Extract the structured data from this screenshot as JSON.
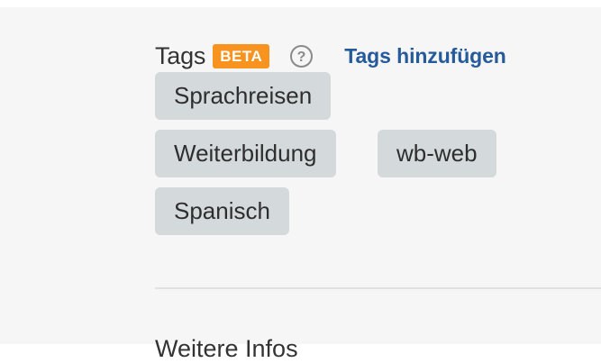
{
  "tags_section": {
    "title": "Tags",
    "badge": "BETA",
    "help_icon": "question-circle-icon",
    "add_link": "Tags hinzufügen",
    "colors": {
      "badge_bg": "#f7931e",
      "link": "#255a9b",
      "tag_bg": "#d4d9dc"
    },
    "tags": [
      "Sprachreisen",
      "Weiterbildung",
      "wb-web",
      "Spanisch"
    ]
  },
  "more_info": {
    "title": "Weitere Infos"
  }
}
